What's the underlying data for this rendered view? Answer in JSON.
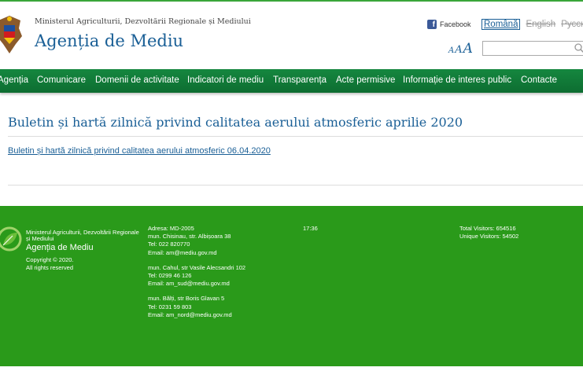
{
  "header": {
    "ministry": "Ministerul Agriculturii, Dezvoltării Regionale și Mediului",
    "agency": "Agenția de Mediu",
    "facebook_label": "Facebook",
    "languages": [
      "Română",
      "English",
      "Русский"
    ],
    "font_size_labels": [
      "A",
      "A",
      "A"
    ],
    "search_placeholder": ""
  },
  "nav": {
    "items": [
      "Agenția",
      "Comunicare",
      "Domenii de activitate",
      "Indicatori de mediu",
      "Transparența",
      "Acte permisive",
      "Informație de interes public",
      "Contacte"
    ]
  },
  "main": {
    "title": "Buletin și hartă zilnică privind calitatea aerului atmosferic aprilie 2020",
    "link": "Buletin și hartă zilnică privind calitatea aerului atmosferic 06.04.2020"
  },
  "footer": {
    "ministry": "Ministerul Agriculturii, Dezvoltării Regionale și Mediului",
    "agency": "Agenția de Mediu",
    "copyright": "Copyright © 2020.",
    "rights": "All rights reserved",
    "addresses": [
      [
        "Adresa: MD-2005",
        "mun. Chisinau, str. Albișoara 38",
        "Tel: 022 820770",
        "Email: am@mediu.gov.md"
      ],
      [
        "mun. Cahul, str Vasile Alecsandri 102",
        "Tel: 0299 46 126",
        "Email: am_sud@mediu.gov.md"
      ],
      [
        "mun. Bălți, str Boris Glavan 5",
        "Tel: 0231 59 803",
        "Email: am_nord@mediu.gov.md"
      ]
    ],
    "time": "17:36",
    "total_visitors": "Total Visitors: 654516",
    "unique_visitors": "Unique Visitors: 54502"
  },
  "colors": {
    "brand_blue": "#1a5f96",
    "nav_green": "#15873f",
    "footer_green": "#2a9a1a"
  },
  "icons": [
    "coat-of-arms-icon",
    "facebook-icon",
    "search-icon",
    "footer-logo-icon"
  ]
}
